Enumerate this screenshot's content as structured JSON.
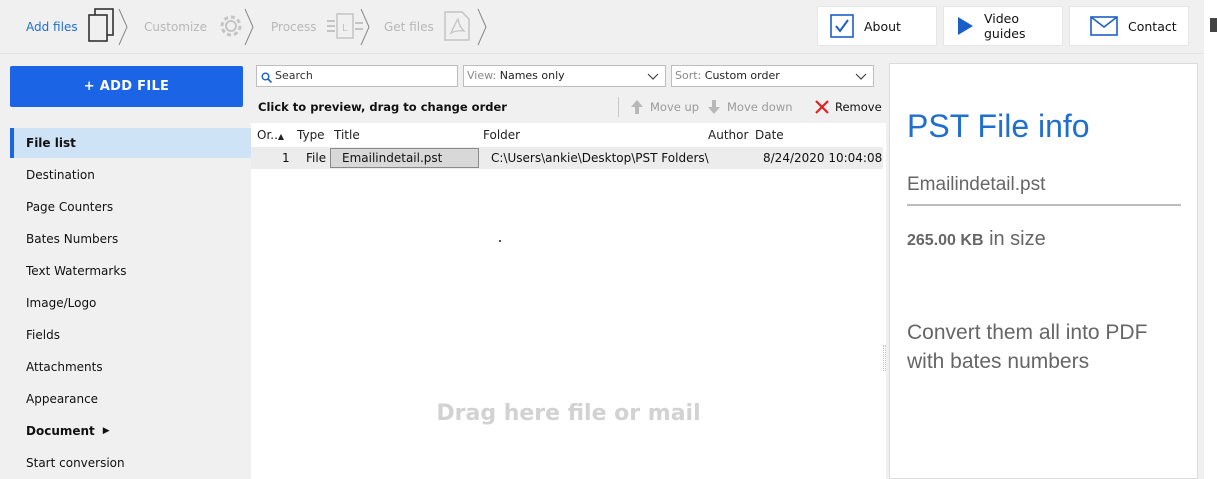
{
  "steps": [
    {
      "label": "Add files",
      "active": true,
      "icon": "files-icon"
    },
    {
      "label": "Customize",
      "active": false,
      "icon": "gear-icon"
    },
    {
      "label": "Process",
      "active": false,
      "icon": "process-icon"
    },
    {
      "label": "Get files",
      "active": false,
      "icon": "pdf-icon"
    }
  ],
  "header_buttons": {
    "about": "About",
    "video_guides": "Video guides",
    "contact": "Contact"
  },
  "sidebar": {
    "add_file": "+ ADD FILE",
    "items": [
      {
        "label": "File list"
      },
      {
        "label": "Destination"
      },
      {
        "label": "Page Counters"
      },
      {
        "label": "Bates Numbers"
      },
      {
        "label": "Text Watermarks"
      },
      {
        "label": "Image/Logo"
      },
      {
        "label": "Fields"
      },
      {
        "label": "Attachments"
      },
      {
        "label": "Appearance"
      },
      {
        "label": "Document"
      },
      {
        "label": "Start conversion"
      }
    ]
  },
  "filelist": {
    "search_placeholder": "Search",
    "view_prefix": "View:",
    "view_value": "Names only",
    "sort_prefix": "Sort:",
    "sort_value": "Custom order",
    "hint": "Click to preview, drag to change order",
    "move_up": "Move up",
    "move_down": "Move down",
    "remove": "Remove",
    "columns": {
      "order": "Or..",
      "type": "Type",
      "title": "Title",
      "folder": "Folder",
      "author": "Author",
      "date": "Date"
    },
    "rows": [
      {
        "order": "1",
        "type": "File",
        "title": "Emailindetail.pst",
        "folder": "C:\\Users\\ankie\\Desktop\\PST Folders\\",
        "author": "",
        "date": "8/24/2020 10:04:08"
      }
    ],
    "drag_text": "Drag here file or mail"
  },
  "info": {
    "title": "PST File info",
    "filename": "Emailindetail.pst",
    "size_value": "265.00 KB",
    "size_suffix": "in size",
    "convert_text": "Convert them all into PDF with bates numbers"
  },
  "colors": {
    "accent": "#1a64e5",
    "title_blue": "#1f6fd0",
    "remove_red": "#e02020"
  }
}
